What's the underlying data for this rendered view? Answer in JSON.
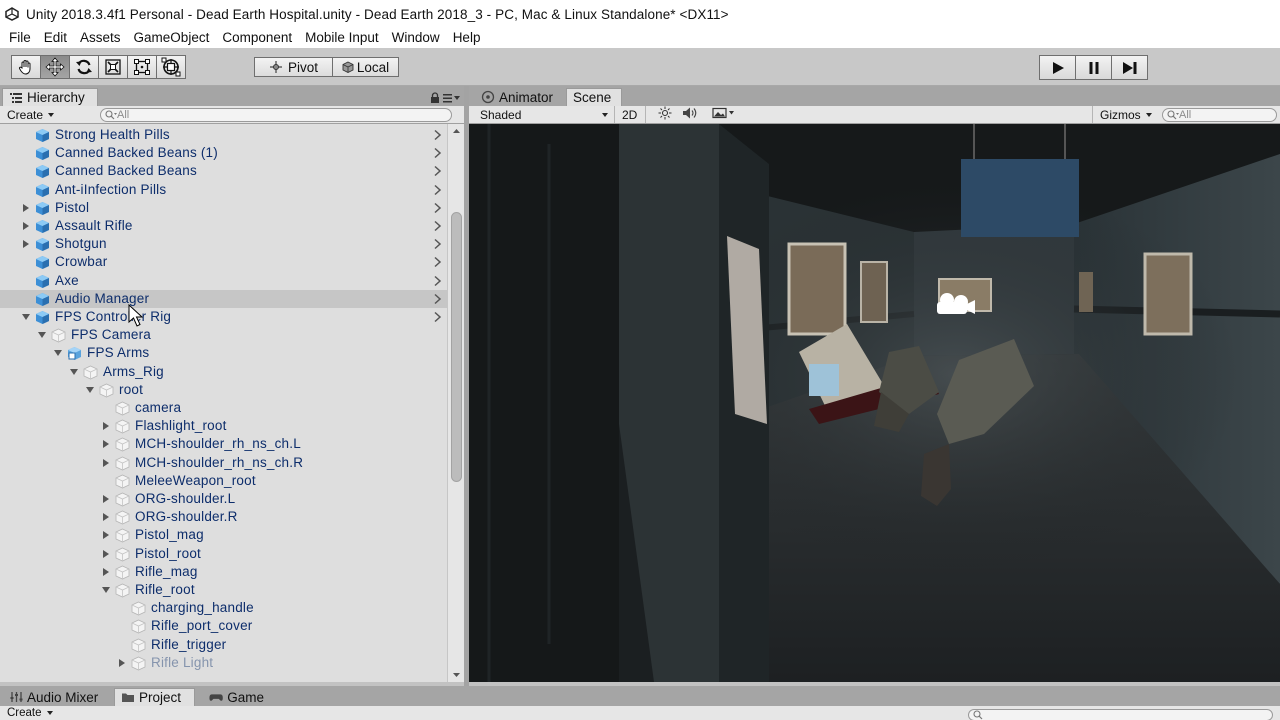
{
  "window": {
    "title": "Unity 2018.3.4f1 Personal - Dead Earth Hospital.unity - Dead Earth 2018_3 - PC, Mac & Linux Standalone* <DX11>"
  },
  "menu": [
    "File",
    "Edit",
    "Assets",
    "GameObject",
    "Component",
    "Mobile Input",
    "Window",
    "Help"
  ],
  "toolbar": {
    "pivot_label": "Pivot",
    "local_label": "Local",
    "transform_tools": [
      "hand-tool-icon",
      "move-tool-icon",
      "rotate-tool-icon",
      "scale-tool-icon",
      "rect-tool-icon",
      "transform-tool-icon"
    ],
    "active_tool": "move-tool-icon"
  },
  "hierarchy": {
    "tab_label": "Hierarchy",
    "create_label": "Create",
    "search_placeholder": "All",
    "rows": [
      {
        "label": "Strong Health Pills",
        "depth": 0,
        "arrow": "none",
        "icon": "prefab",
        "chevron": true
      },
      {
        "label": "Canned Backed Beans (1)",
        "depth": 0,
        "arrow": "none",
        "icon": "prefab",
        "chevron": true
      },
      {
        "label": "Canned Backed Beans",
        "depth": 0,
        "arrow": "none",
        "icon": "prefab",
        "chevron": true
      },
      {
        "label": "Ant-iInfection Pills",
        "depth": 0,
        "arrow": "none",
        "icon": "prefab",
        "chevron": true
      },
      {
        "label": "Pistol",
        "depth": 0,
        "arrow": "collapsed",
        "icon": "prefab",
        "chevron": true
      },
      {
        "label": "Assault Rifle",
        "depth": 0,
        "arrow": "collapsed",
        "icon": "prefab",
        "chevron": true
      },
      {
        "label": "Shotgun",
        "depth": 0,
        "arrow": "collapsed",
        "icon": "prefab",
        "chevron": true
      },
      {
        "label": "Crowbar",
        "depth": 0,
        "arrow": "none",
        "icon": "prefab",
        "chevron": true
      },
      {
        "label": "Axe",
        "depth": 0,
        "arrow": "none",
        "icon": "prefab",
        "chevron": true
      },
      {
        "label": "Audio Manager",
        "depth": 0,
        "arrow": "none",
        "icon": "prefab",
        "chevron": true,
        "highlight": true
      },
      {
        "label": "FPS Controller Rig",
        "depth": 0,
        "arrow": "expanded",
        "icon": "prefab",
        "chevron": true
      },
      {
        "label": "FPS Camera",
        "depth": 1,
        "arrow": "expanded",
        "icon": "gameobject",
        "chevron": false
      },
      {
        "label": "FPS Arms",
        "depth": 2,
        "arrow": "expanded",
        "icon": "prefab-model",
        "chevron": false
      },
      {
        "label": "Arms_Rig",
        "depth": 3,
        "arrow": "expanded",
        "icon": "gameobject",
        "chevron": false
      },
      {
        "label": "root",
        "depth": 4,
        "arrow": "expanded",
        "icon": "gameobject",
        "chevron": false
      },
      {
        "label": "camera",
        "depth": 5,
        "arrow": "none",
        "icon": "gameobject",
        "chevron": false
      },
      {
        "label": "Flashlight_root",
        "depth": 5,
        "arrow": "collapsed",
        "icon": "gameobject",
        "chevron": false
      },
      {
        "label": "MCH-shoulder_rh_ns_ch.L",
        "depth": 5,
        "arrow": "collapsed",
        "icon": "gameobject",
        "chevron": false
      },
      {
        "label": "MCH-shoulder_rh_ns_ch.R",
        "depth": 5,
        "arrow": "collapsed",
        "icon": "gameobject",
        "chevron": false
      },
      {
        "label": "MeleeWeapon_root",
        "depth": 5,
        "arrow": "none",
        "icon": "gameobject",
        "chevron": false
      },
      {
        "label": "ORG-shoulder.L",
        "depth": 5,
        "arrow": "collapsed",
        "icon": "gameobject",
        "chevron": false
      },
      {
        "label": "ORG-shoulder.R",
        "depth": 5,
        "arrow": "collapsed",
        "icon": "gameobject",
        "chevron": false
      },
      {
        "label": "Pistol_mag",
        "depth": 5,
        "arrow": "collapsed",
        "icon": "gameobject",
        "chevron": false
      },
      {
        "label": "Pistol_root",
        "depth": 5,
        "arrow": "collapsed",
        "icon": "gameobject",
        "chevron": false
      },
      {
        "label": "Rifle_mag",
        "depth": 5,
        "arrow": "collapsed",
        "icon": "gameobject",
        "chevron": false
      },
      {
        "label": "Rifle_root",
        "depth": 5,
        "arrow": "expanded",
        "icon": "gameobject",
        "chevron": false
      },
      {
        "label": "charging_handle",
        "depth": 6,
        "arrow": "none",
        "icon": "gameobject",
        "chevron": false
      },
      {
        "label": "Rifle_port_cover",
        "depth": 6,
        "arrow": "none",
        "icon": "gameobject",
        "chevron": false
      },
      {
        "label": "Rifle_trigger",
        "depth": 6,
        "arrow": "none",
        "icon": "gameobject",
        "chevron": false
      },
      {
        "label": "Rifle Light",
        "depth": 6,
        "arrow": "collapsed",
        "icon": "gameobject",
        "chevron": false,
        "dim": true
      }
    ]
  },
  "scene_panel": {
    "tabs": [
      "Animator",
      "Scene"
    ],
    "selected_tab": "Scene",
    "shading_mode": "Shaded",
    "mode_2d_label": "2D",
    "gizmos_label": "Gizmos",
    "search_placeholder": "All"
  },
  "bottom": {
    "tabs": [
      "Audio Mixer",
      "Project",
      "Game"
    ],
    "selected_tab": "Project",
    "create_label": "Create"
  }
}
